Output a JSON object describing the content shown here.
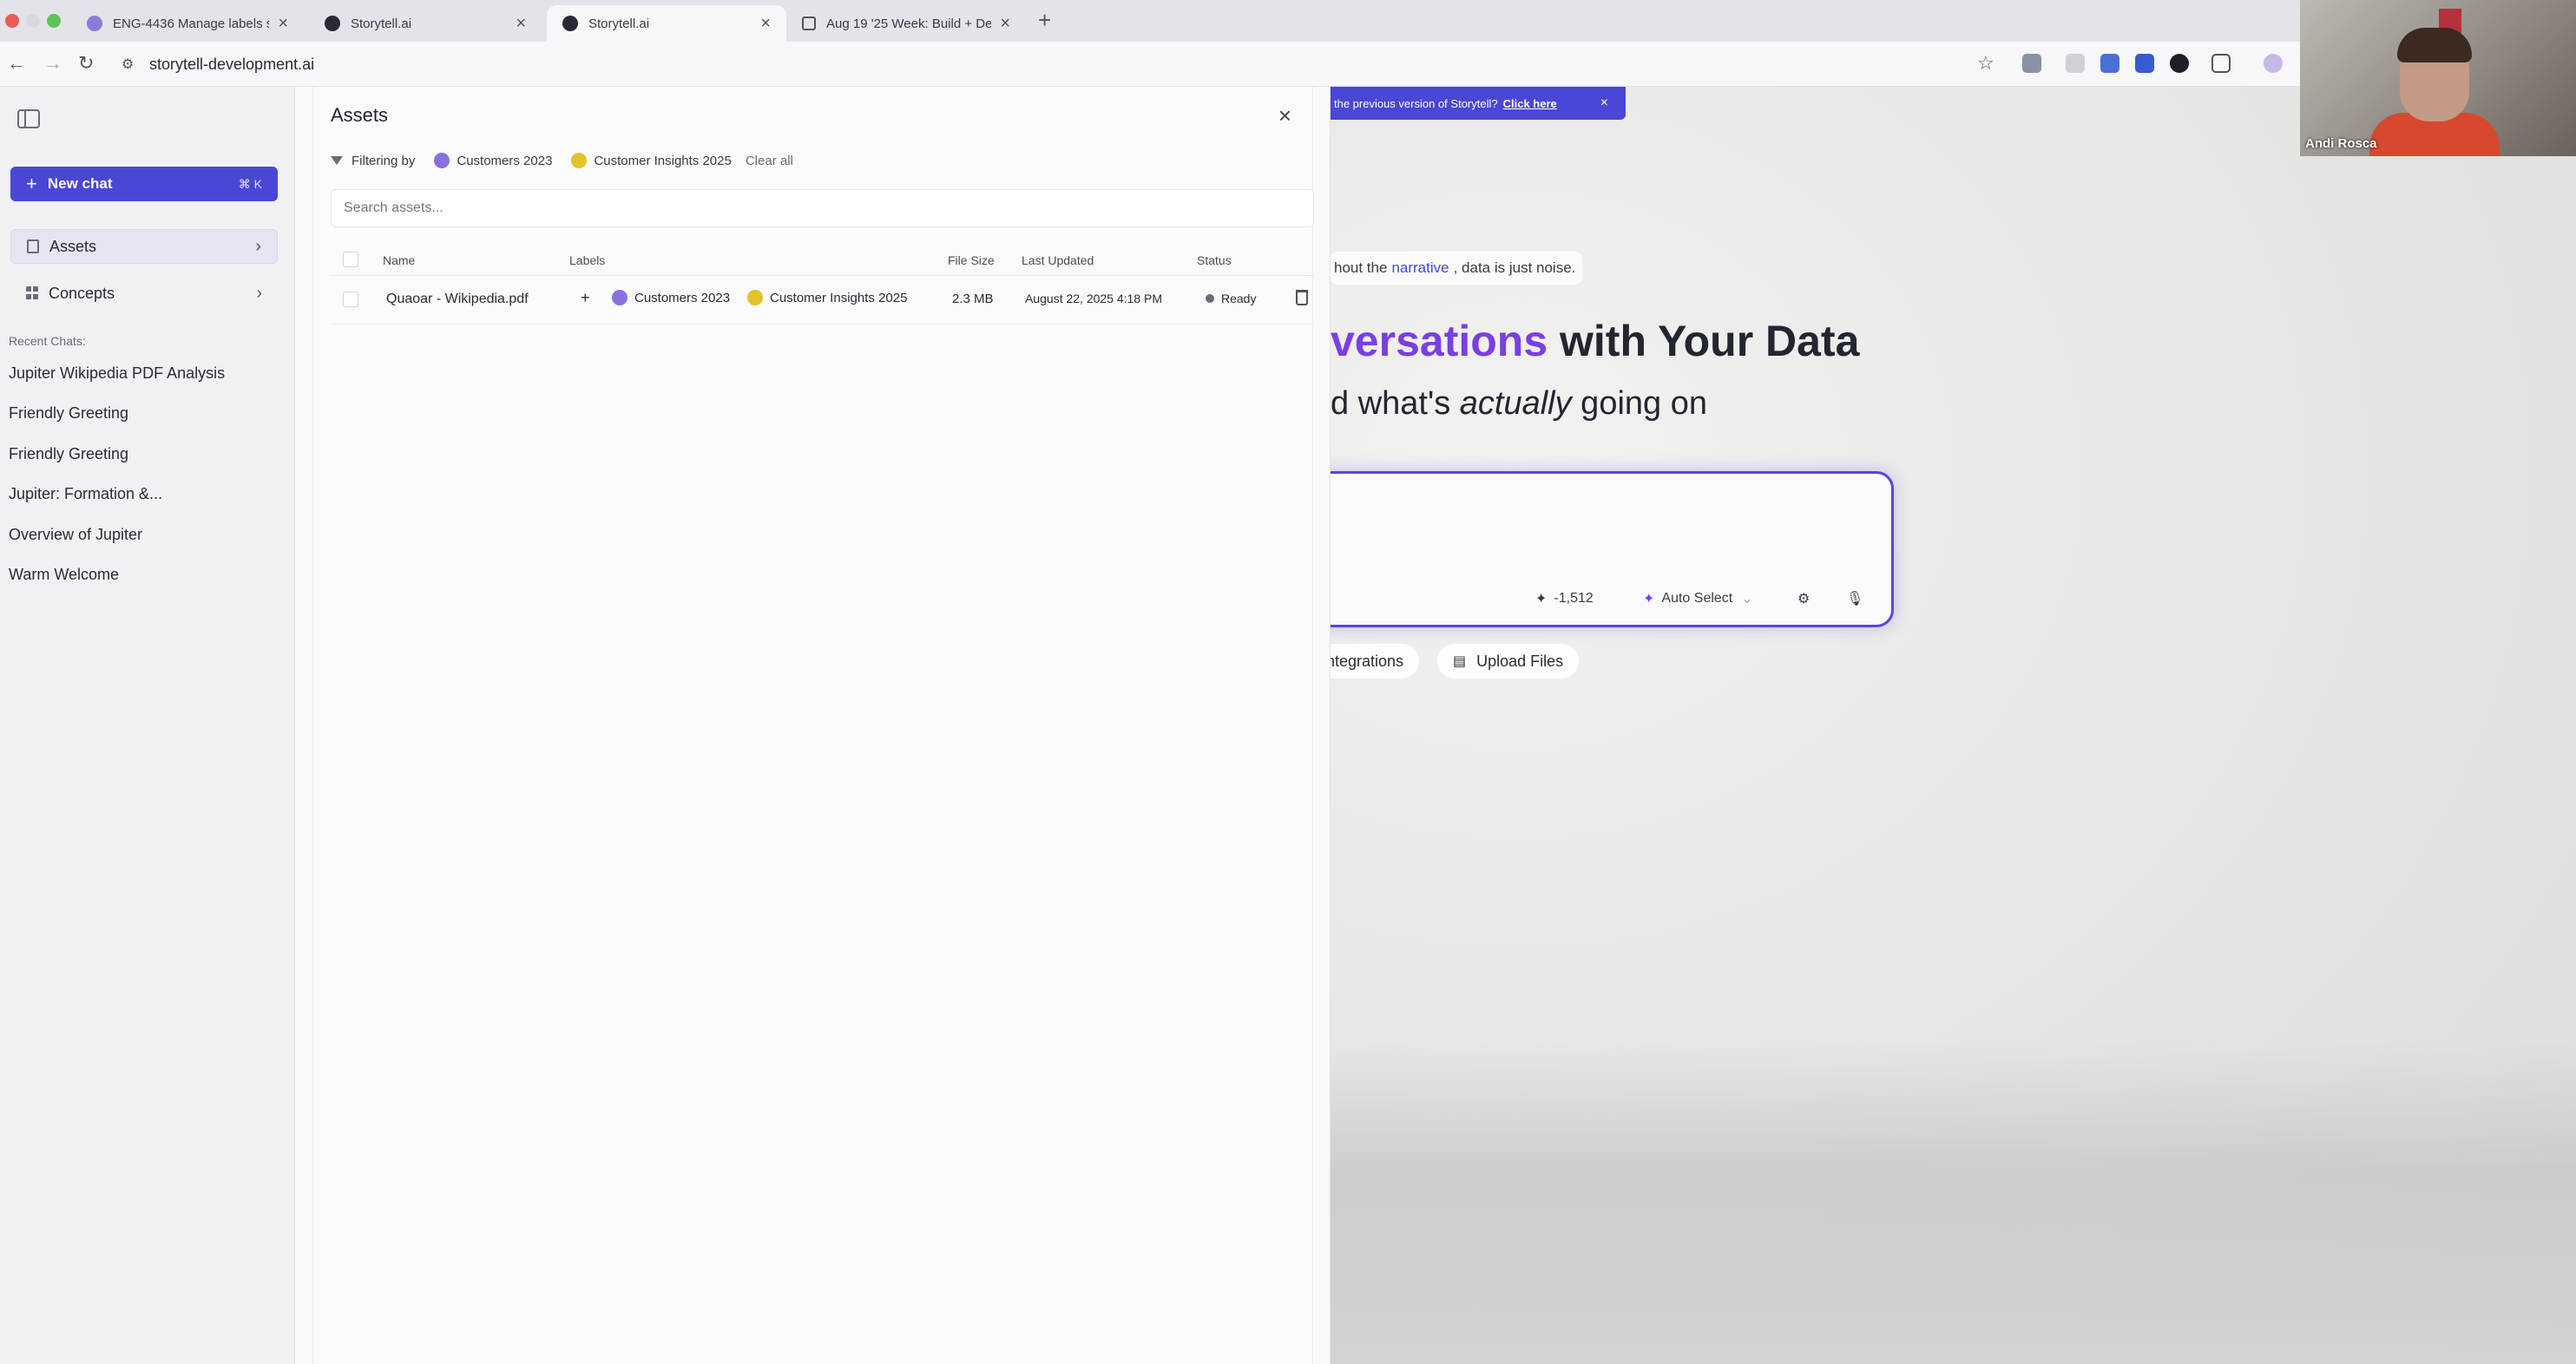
{
  "browser": {
    "tabs": [
      {
        "label": "ENG-4436 Manage labels sc",
        "active": false
      },
      {
        "label": "Storytell.ai",
        "active": false
      },
      {
        "label": "Storytell.ai",
        "active": true
      },
      {
        "label": "Aug 19 '25 Week: Build + De",
        "active": false
      }
    ],
    "new_tab": "+",
    "url": "storytell-development.ai"
  },
  "sidebar": {
    "new_chat_label": "New chat",
    "new_chat_shortcut": "⌘ K",
    "nav": [
      {
        "label": "Assets",
        "icon": "document-icon",
        "selected": true
      },
      {
        "label": "Concepts",
        "icon": "grid-icon",
        "selected": false
      }
    ],
    "recent_heading": "Recent Chats:",
    "recent_chats": [
      "Jupiter Wikipedia PDF Analysis",
      "Friendly Greeting",
      "Friendly Greeting",
      "Jupiter: Formation &...",
      "Overview of Jupiter",
      "Warm Welcome"
    ]
  },
  "assets_panel": {
    "title": "Assets",
    "filter_label": "Filtering by",
    "filters": [
      {
        "label": "Customers 2023",
        "color": "#8a6fe0"
      },
      {
        "label": "Customer Insights 2025",
        "color": "#e4c22a"
      }
    ],
    "clear_all": "Clear all",
    "search_placeholder": "Search assets...",
    "columns": {
      "name": "Name",
      "labels": "Labels",
      "file_size": "File Size",
      "last_updated": "Last Updated",
      "status": "Status"
    },
    "rows": [
      {
        "name": "Quaoar - Wikipedia.pdf",
        "add_label": "+",
        "labels": [
          {
            "label": "Customers 2023",
            "color": "#8a6fe0"
          },
          {
            "label": "Customer Insights 2025",
            "color": "#e4c22a"
          }
        ],
        "file_size": "2.3 MB",
        "last_updated": "August 22, 2025 4:18 PM",
        "status": "Ready"
      }
    ]
  },
  "background_app": {
    "banner_text": "the previous version of Storytell?",
    "banner_link": "Click here",
    "banner_close": "×",
    "tagline_before": "hout the",
    "tagline_highlight": "narrative",
    "tagline_after": ", data is just noise.",
    "hero_gradient": "versations",
    "hero_rest": " with Your Data",
    "subhero_before": "d what's ",
    "subhero_italic": "actually",
    "subhero_after": " going on",
    "token_count": "-1,512",
    "model_select": "Auto Select",
    "integrations_label": "ntegrations",
    "upload_label": "Upload Files"
  },
  "webcam": {
    "name": "Andi Rosca"
  },
  "colors": {
    "accent": "#4a46d6",
    "hero_purple": "#7a3fe0"
  }
}
